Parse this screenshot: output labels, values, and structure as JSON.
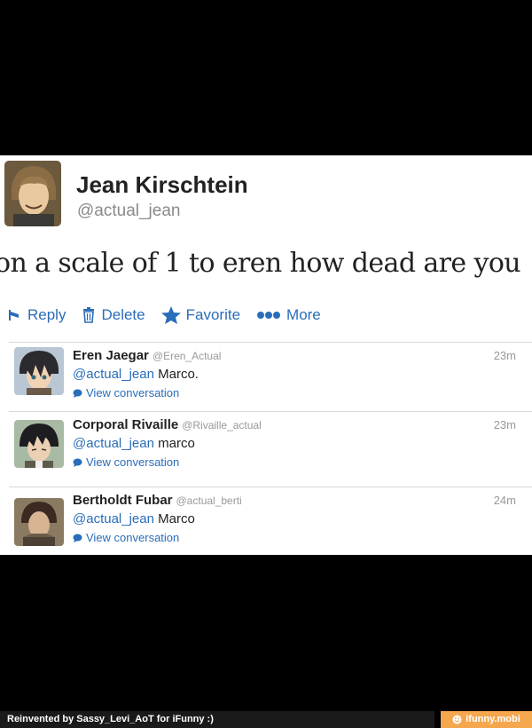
{
  "tweet": {
    "author_name": "Jean Kirschtein",
    "author_handle": "@actual_jean",
    "text": "on a scale of 1 to eren how dead are you"
  },
  "actions": {
    "reply_label": "Reply",
    "delete_label": "Delete",
    "favorite_label": "Favorite",
    "more_label": "More"
  },
  "replies": [
    {
      "name": "Eren Jaegar",
      "handle": "@Eren_Actual",
      "time": "23m",
      "mention": "@actual_jean",
      "text": " Marco.",
      "view_label": "View conversation"
    },
    {
      "name": "Corporal Rivaille",
      "handle": "@Rivaille_actual",
      "time": "23m",
      "mention": "@actual_jean",
      "text": " marco",
      "view_label": "View conversation"
    },
    {
      "name": "Bertholdt Fubar",
      "handle": "@actual_berti",
      "time": "24m",
      "mention": "@actual_jean",
      "text": " Marco",
      "view_label": "View conversation"
    }
  ],
  "footer": {
    "credit": "Reinvented by Sassy_Levi_AoT for iFunny :)",
    "brand": "ifunny.mobi"
  },
  "colors": {
    "link": "#2a6db8",
    "brand": "#f5a74e"
  }
}
